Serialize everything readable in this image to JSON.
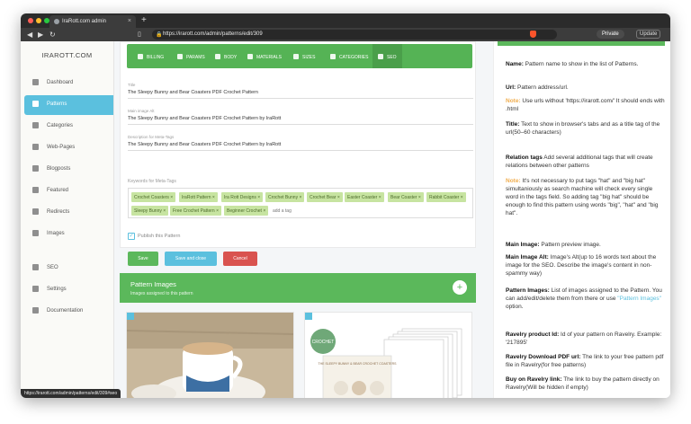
{
  "browser": {
    "tab_title": "IraRott.com admin",
    "tab_close": "×",
    "new_tab": "+",
    "url": "https://irarott.com/admin/patterns/edit/309",
    "private_label": "Private",
    "update_label": "Update",
    "status_url": "https://irarott.com/admin/patterns/edit/309#seo"
  },
  "sidebar": {
    "logo": "IRAROTT.COM",
    "items": [
      {
        "label": "Dashboard",
        "icon": "dashboard-icon"
      },
      {
        "label": "Patterns",
        "icon": "patterns-icon"
      },
      {
        "label": "Categories",
        "icon": "categories-icon"
      },
      {
        "label": "Web-Pages",
        "icon": "webpages-icon"
      },
      {
        "label": "Blogposts",
        "icon": "blogposts-icon"
      },
      {
        "label": "Featured",
        "icon": "featured-icon"
      },
      {
        "label": "Redirects",
        "icon": "redirects-icon"
      },
      {
        "label": "Images",
        "icon": "images-icon"
      },
      {
        "label": "SEO",
        "icon": "seo-icon"
      },
      {
        "label": "Settings",
        "icon": "settings-icon"
      },
      {
        "label": "Documentation",
        "icon": "documentation-icon"
      }
    ],
    "active": "Patterns"
  },
  "form_tabs": [
    "BILLING",
    "PARAMS",
    "BODY",
    "MATERIALS",
    "SIZES",
    "CATEGORIES",
    "SEO"
  ],
  "active_tab": "SEO",
  "fields": {
    "title_label": "Title",
    "title_value": "The Sleepy Bunny and Bear Coasters PDF Crochet Pattern",
    "alt_label": "Main image Alt",
    "alt_value": "The Sleepy Bunny and Bear Coasters PDF Crochet Pattern by IraRott",
    "desc_label": "Description for Meta-Tags",
    "desc_value": "The Sleepy Bunny and Bear Coasters PDF Crochet Pattern by IraRott",
    "keywords_label": "Keywords for Meta-Tags",
    "keywords": [
      "Crochet Coasters",
      "IraRott Pattern",
      "Ira Rott Designs",
      "Crochet Bunny",
      "Crochet Bear",
      "Easter Coaster",
      "Bear Coaster",
      "Rabbit Coaster",
      "Sleepy Bunny",
      "Free Crochet Pattern",
      "Beginner Crochet"
    ],
    "chip_remove": "×",
    "add_tag_placeholder": "add a tag",
    "checkbox_mark": "✓",
    "publish_label": "Publish this Pattern",
    "publish_checked": true
  },
  "buttons": {
    "save": "Save",
    "save_close": "Save and close",
    "cancel": "Cancel"
  },
  "images_section": {
    "title": "Pattern Images",
    "subtitle": "Images assigned to this pattern",
    "add": "+"
  },
  "thumb_text": {
    "badge": "CROCHET",
    "cover_title": "THE SLEEPY BUNNY & BEAR CROCHET COASTERS"
  },
  "help": [
    {
      "term": "Name:",
      "text": " Pattern name to show in the list of Patterns."
    },
    {
      "term": "Url:",
      "text": " Pattern address/url."
    },
    {
      "note": "Note:",
      "text": " Use urls without 'https://irarott.com/' It should ends with .html"
    },
    {
      "term": "Title:",
      "text": " Text to show in browser's tabs and as a title tag of the url(50–60 characters)"
    },
    {
      "term": "Relation tags",
      "text": " Add several additional tags that will create relations between other patterns"
    },
    {
      "note": "Note:",
      "text": " It's not necessary to put tags \"hat\" and \"big hat\" simultaniously as search machine will check every single word in the tags field. So adding tag \"big hat\" should be enough to find this pattern using words \"big\", \"hat\" and \"big hat\"."
    },
    {
      "term": "Main Image:",
      "text": " Pattern preview image."
    },
    {
      "term": "Main Image Alt:",
      "text": " Image's Alt(up to 16 words text about the image for the SEO. Describe the image's content in non-spammy way)"
    },
    {
      "term": "Pattern Images:",
      "text": " List of images assigned to the Pattern. You can add/edit/delete them from there or use ",
      "link": "\"Pattern Images\"",
      "tail": " option."
    },
    {
      "term": "Ravelry product Id:",
      "text": " Id of your pattern on Ravelry. Example: '217895'"
    },
    {
      "term": "Ravelry Download PDF url:",
      "text": " The link to your free pattern pdf file in Ravelry(for free patterns)"
    },
    {
      "term": "Buy on Ravelry link:",
      "text": " The link to buy the pattern directly on Ravelry(Will be hidden if empty)"
    }
  ],
  "colors": {
    "accent_green": "#55b355",
    "active_blue": "#5bc0de",
    "chip_green": "#c7e4a1",
    "cancel_red": "#d9534f",
    "note_orange": "#f0ad4e"
  }
}
